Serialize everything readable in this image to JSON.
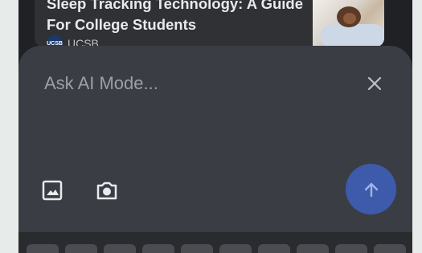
{
  "news": {
    "title_line1": "Sleep Tracking Technology: A Guide",
    "title_line2": "For College Students",
    "source": "UCSB",
    "source_logo_text": "UCSB"
  },
  "composer": {
    "placeholder": "Ask AI Mode...",
    "close_icon": "close-icon",
    "gallery_icon": "image-icon",
    "camera_icon": "camera-icon",
    "send_icon": "arrow-up-icon",
    "send_color": "#3e5bab"
  },
  "keyboard": {
    "visible_keys": 10
  }
}
